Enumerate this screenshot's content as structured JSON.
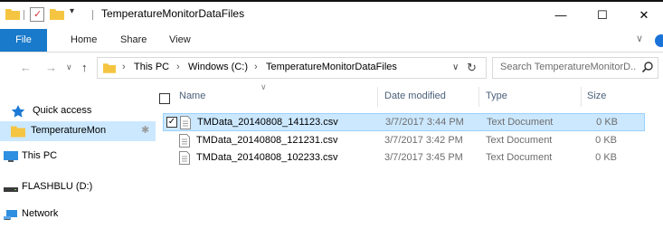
{
  "window": {
    "title": "TemperatureMonitorDataFiles",
    "minimize_glyph": "—",
    "maximize_glyph": "☐",
    "close_glyph": "✕"
  },
  "ribbon": {
    "tabs": [
      "File",
      "Home",
      "Share",
      "View"
    ],
    "expand_glyph": "∨"
  },
  "address": {
    "back_glyph": "←",
    "forward_glyph": "→",
    "up_glyph": "↑",
    "breadcrumb": [
      "This PC",
      "Windows (C:)",
      "TemperatureMonitorDataFiles"
    ],
    "separator": "›",
    "dropdown_glyph": "∨",
    "refresh_glyph": "↻",
    "search_placeholder": "Search TemperatureMonitorD..."
  },
  "nav_pane": {
    "items": [
      {
        "label": "Quick access",
        "icon": "star-icon"
      },
      {
        "label": "TemperatureMon",
        "icon": "folder-icon",
        "pinned": true
      },
      {
        "label": "This PC",
        "icon": "computer-icon"
      },
      {
        "label": "FLASHBLU (D:)",
        "icon": "drive-icon"
      },
      {
        "label": "Network",
        "icon": "network-icon"
      }
    ],
    "pin_glyph": "✱"
  },
  "file_list": {
    "columns": [
      "Name",
      "Date modified",
      "Type",
      "Size"
    ],
    "sort_glyph": "∨",
    "rows": [
      {
        "name": "TMData_20140808_141123.csv",
        "date": "3/7/2017 3:44 PM",
        "type": "Text Document",
        "size": "0 KB",
        "selected": true
      },
      {
        "name": "TMData_20140808_121231.csv",
        "date": "3/7/2017 3:42 PM",
        "type": "Text Document",
        "size": "0 KB",
        "selected": false
      },
      {
        "name": "TMData_20140808_102233.csv",
        "date": "3/7/2017 3:45 PM",
        "type": "Text Document",
        "size": "0 KB",
        "selected": false
      }
    ],
    "check_glyph": "✓"
  },
  "colors": {
    "accent": "#1979ca",
    "selection": "#cce8ff",
    "selection_border": "#99d1ff",
    "folder": "#f5c542"
  }
}
